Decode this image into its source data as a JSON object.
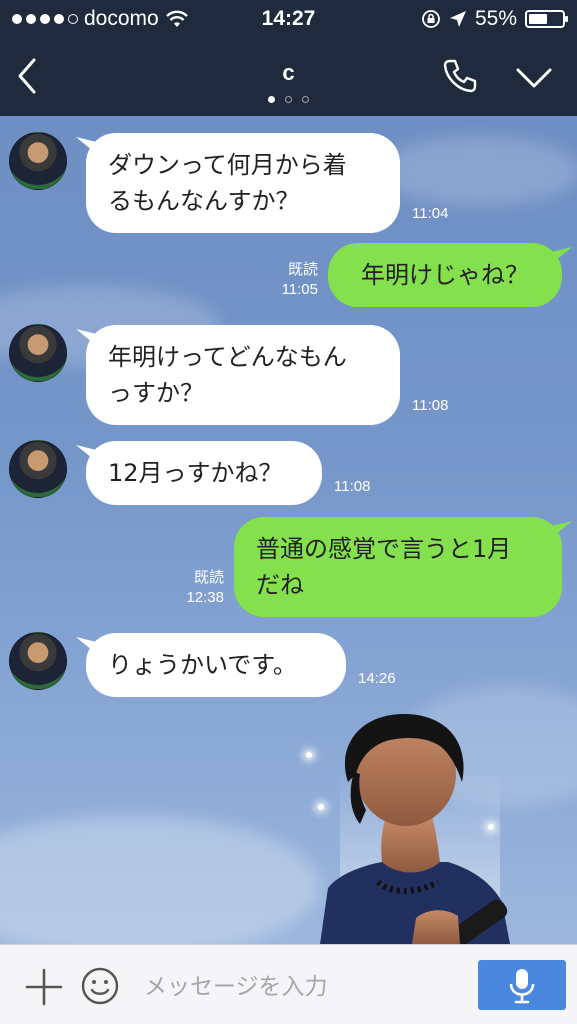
{
  "status_bar": {
    "carrier": "docomo",
    "time": "14:27",
    "battery": "55%",
    "battery_level": 0.55,
    "signal_bars_filled": 4,
    "signal_bars_total": 5
  },
  "nav": {
    "title": "c",
    "page_indicator_count": 3,
    "page_indicator_active": 1
  },
  "messages": [
    {
      "side": "in",
      "text_lines": [
        "ダウンって何月から着",
        "るもんなんすか？"
      ],
      "time": "11:04"
    },
    {
      "side": "out",
      "text_lines": [
        "年明けじゃね？"
      ],
      "read": "既読",
      "time": "11:05"
    },
    {
      "side": "in",
      "text_lines": [
        "年明けってどんなもん",
        "っすか？"
      ],
      "time": "11:08"
    },
    {
      "side": "in",
      "text_lines": [
        "12月っすかね？"
      ],
      "time": "11:08"
    },
    {
      "side": "out",
      "text_lines": [
        "普通の感覚で言うと1月",
        "だね"
      ],
      "read": "既読",
      "time": "12:38"
    },
    {
      "side": "in",
      "text_lines": [
        "りょうかいです。"
      ],
      "time": "14:26"
    }
  ],
  "input": {
    "placeholder": "メッセージを入力"
  },
  "icons": {
    "back": "back-chevron-icon",
    "call": "phone-icon",
    "menu": "chevron-down-icon",
    "add": "plus-icon",
    "emoji": "smiley-icon",
    "voice": "microphone-icon",
    "wifi": "wifi-icon",
    "lock": "rotation-lock-icon",
    "location": "location-arrow-icon"
  },
  "colors": {
    "header_bg": "#1f2a3d",
    "outgoing_bubble": "#84e04c",
    "incoming_bubble": "#ffffff",
    "mic_button": "#4a88df"
  }
}
